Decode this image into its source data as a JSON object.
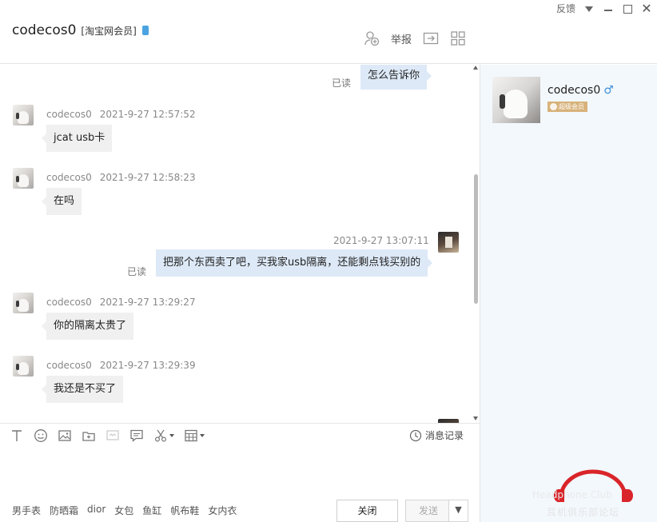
{
  "window": {
    "feedback": "反馈"
  },
  "header": {
    "contact_name": "codecos0",
    "member_tag": "[淘宝网会员]",
    "report_label": "举报"
  },
  "messages": [
    {
      "direction": "out",
      "text": "怎么告诉你",
      "read_label": "已读"
    },
    {
      "direction": "in",
      "sender": "codecos0",
      "time": "2021-9-27 12:57:52",
      "text": "jcat usb卡"
    },
    {
      "direction": "in",
      "sender": "codecos0",
      "time": "2021-9-27 12:58:23",
      "text": "在吗"
    },
    {
      "direction": "out",
      "time": "2021-9-27 13:07:11",
      "text": "把那个东西卖了吧，买我家usb隔离，还能剩点钱买别的",
      "read_label": "已读"
    },
    {
      "direction": "in",
      "sender": "codecos0",
      "time": "2021-9-27 13:29:27",
      "text": "你的隔离太贵了"
    },
    {
      "direction": "in",
      "sender": "codecos0",
      "time": "2021-9-27 13:29:39",
      "text": "我还是不买了"
    }
  ],
  "composer": {
    "history_label": "消息记录",
    "quick_phrases": [
      "男手表",
      "防晒霜",
      "dior",
      "女包",
      "鱼缸",
      "帆布鞋",
      "女内衣"
    ],
    "close_label": "关闭",
    "send_label": "发送"
  },
  "profile": {
    "name": "codecos0",
    "gender_symbol": "♂",
    "vip_label": "超级会员"
  },
  "watermark": {
    "line1": "Headphone Club",
    "line2": "耳机俱乐部论坛"
  },
  "colors": {
    "incoming_bubble": "#f0f0f0",
    "outgoing_bubble": "#dde9f7",
    "side_panel": "#f3f8fd",
    "gender_blue": "#3b8fd9",
    "vip_gold": "#d8b27a",
    "watermark_red": "#d9252a"
  }
}
